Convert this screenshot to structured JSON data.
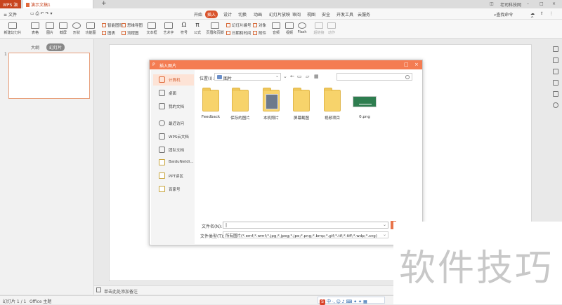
{
  "titlebar": {
    "app_tab": "WPS 演示",
    "doc_tab": "演示文稿1",
    "new_tab": "+",
    "user": "老司科技网"
  },
  "menubar": {
    "file_menu": "文件",
    "tabs": [
      "开始",
      "插入",
      "设计",
      "切换",
      "动画",
      "幻灯片放映",
      "审阅",
      "视图",
      "安全",
      "开发工具",
      "云服务"
    ],
    "active_tab": "插入",
    "search": "查找命令"
  },
  "toolbar": {
    "new_slide": "新建幻灯片",
    "table": "表格",
    "picture": "图片",
    "screenshot": "截屏",
    "shape": "形状",
    "icons": "功能图",
    "smart_graphic": "智能图形",
    "chart": "图表",
    "mindmap": "思维导图",
    "flowchart": "流程图",
    "textbox": "文本框",
    "art_text": "艺术字",
    "symbol": "符号",
    "formula": "公式",
    "header_footer": "页眉和页脚",
    "slide_number": "幻灯片编号",
    "object": "对象",
    "date_time": "日期和时间",
    "attachment": "附件",
    "audio": "音频",
    "video": "视频",
    "flash": "Flash",
    "hyperlink": "超链接",
    "action": "动作"
  },
  "leftpanel": {
    "tab_outline": "大纲",
    "tab_slides": "幻灯片",
    "slide_number": "1"
  },
  "notes": "单击此处添加备注",
  "statusbar": {
    "slide_info": "幻灯片 1 / 1",
    "theme": "Office 主题",
    "ime_logo": "S",
    "ime_text": "中 ·, ☺ ♪ ⌨ ✦ ✦ ▦"
  },
  "dialog": {
    "title": "插入图片",
    "logo": "P",
    "minimize": "□",
    "close": "×",
    "sidebar": [
      {
        "label": "计算机",
        "icon": "computer-icon",
        "active": true
      },
      {
        "label": "桌面",
        "icon": "desktop-icon"
      },
      {
        "label": "我的文档",
        "icon": "documents-icon"
      },
      {
        "label": "最近访问",
        "icon": "clock-icon"
      },
      {
        "label": "WPS云文档",
        "icon": "cloud-icon"
      },
      {
        "label": "团队文档",
        "icon": "team-icon"
      },
      {
        "label": "BaiduNetdi...",
        "icon": "folder-icon"
      },
      {
        "label": "PPT讲区",
        "icon": "folder-icon"
      },
      {
        "label": "百家号",
        "icon": "folder-icon"
      }
    ],
    "location_label": "位置(I):",
    "location_value": "图片",
    "files": [
      {
        "name": "Feedback",
        "type": "folder"
      },
      {
        "name": "保存的图片",
        "type": "folder"
      },
      {
        "name": "本机照片",
        "type": "photo-folder"
      },
      {
        "name": "屏幕截图",
        "type": "folder"
      },
      {
        "name": "视频项目",
        "type": "folder"
      },
      {
        "name": "0.png",
        "type": "png"
      }
    ],
    "filename_label": "文件名(N):",
    "filename_value": "|",
    "filetype_label": "文件类型(T):",
    "filetype_value": "所有图片(*.emf;*.wmf;*.jpg;*.jpeg;*.jpe;*.png;*.bmp;*.gif;*.tif;*.tiff;*.wdp;*.svg)"
  },
  "watermark": "软件技巧",
  "colors": {
    "accent": "#d9532c",
    "dialog_title": "#f47c52",
    "sidebar_active": "#fde3d6"
  }
}
